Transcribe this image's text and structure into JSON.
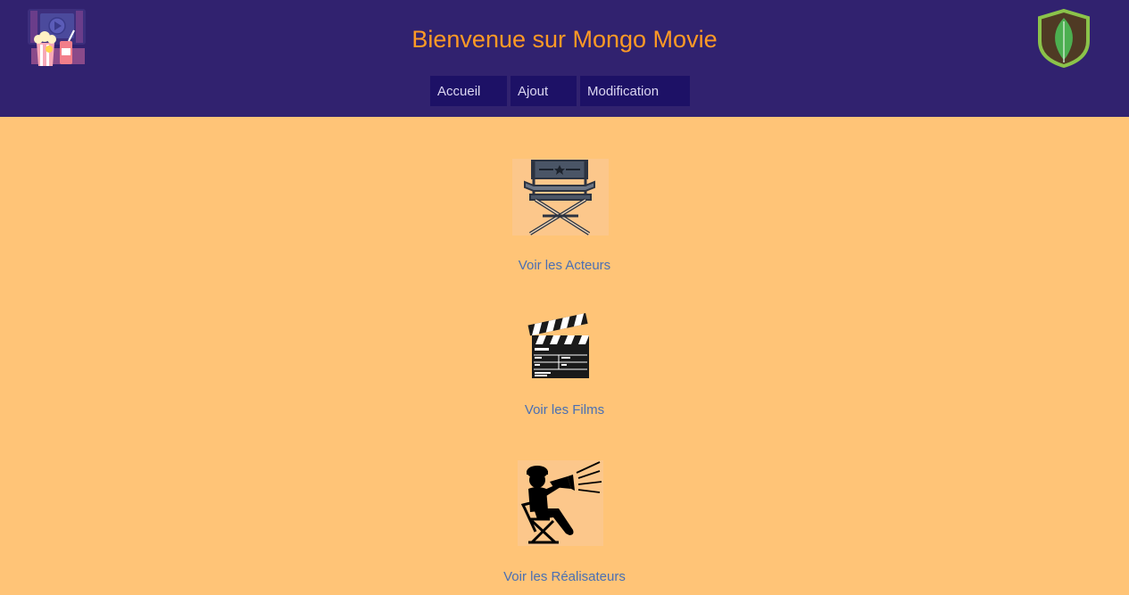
{
  "header": {
    "title": "Bienvenue sur Mongo Movie",
    "left_logo_icon": "cinema-popcorn-icon",
    "right_logo_icon": "mongodb-leaf-icon"
  },
  "nav": {
    "items": [
      {
        "label": "Accueil"
      },
      {
        "label": "Ajout"
      },
      {
        "label": "Modification"
      }
    ]
  },
  "main": {
    "tiles": [
      {
        "label": "Voir les Acteurs",
        "icon": "director-chair-icon"
      },
      {
        "label": "Voir les Films",
        "icon": "clapperboard-icon"
      },
      {
        "label": "Voir les Réalisateurs",
        "icon": "director-megaphone-icon"
      }
    ]
  },
  "colors": {
    "header_bg": "#31226f",
    "nav_bg": "#1d1166",
    "page_bg": "#ffc477",
    "title_color": "#ff9a25",
    "link_color": "#4a6fb3"
  }
}
